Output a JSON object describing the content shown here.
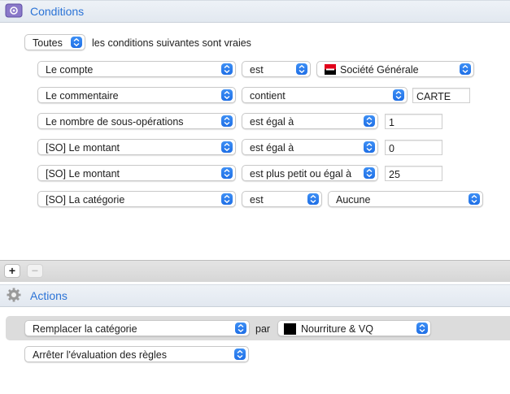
{
  "conditions": {
    "title": "Conditions",
    "match_select": "Toutes",
    "match_text": "les conditions suivantes sont vraies",
    "rows": [
      {
        "field": "Le compte",
        "operator": "est",
        "value": "Société Générale"
      },
      {
        "field": "Le commentaire",
        "operator": "contient",
        "value": "CARTE"
      },
      {
        "field": "Le nombre de sous-opérations",
        "operator": "est égal à",
        "value": "1"
      },
      {
        "field": "[SO] Le montant",
        "operator": "est égal à",
        "value": "0"
      },
      {
        "field": "[SO] Le montant",
        "operator": "est plus petit ou égal à",
        "value": "25"
      },
      {
        "field": "[SO] La catégorie",
        "operator": "est",
        "value": "Aucune"
      }
    ],
    "add_label": "+",
    "remove_label": "−"
  },
  "actions": {
    "title": "Actions",
    "rows": [
      {
        "action": "Remplacer la catégorie",
        "connector": "par",
        "value": "Nourriture & VQ"
      },
      {
        "action": "Arrêter l'évaluation des règles"
      }
    ]
  },
  "colors": {
    "accent": "#2b73d6",
    "bank_logo_red": "#e2001a",
    "category_swatch": "#000000"
  },
  "icons": {
    "conditions": "filter-gear-icon",
    "actions": "gear-icon",
    "popup": "updown-chevron-icon"
  }
}
